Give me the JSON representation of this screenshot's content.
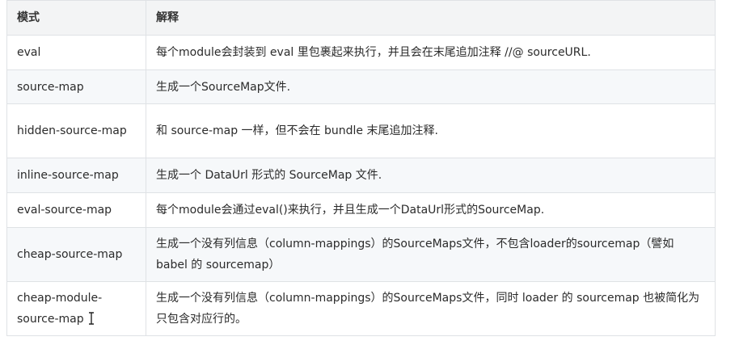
{
  "table": {
    "headers": [
      "模式",
      "解释"
    ],
    "rows": [
      {
        "mode": "eval",
        "desc": "每个module会封装到 eval 里包裹起来执行，并且会在末尾追加注释 //@ sourceURL."
      },
      {
        "mode": "source-map",
        "desc": "生成一个SourceMap文件."
      },
      {
        "mode": "hidden-source-map",
        "desc": "和 source-map 一样，但不会在 bundle 末尾追加注释."
      },
      {
        "mode": "inline-source-map",
        "desc": "生成一个 DataUrl 形式的 SourceMap 文件."
      },
      {
        "mode": "eval-source-map",
        "desc": "每个module会通过eval()来执行，并且生成一个DataUrl形式的SourceMap."
      },
      {
        "mode": "cheap-source-map",
        "desc": "生成一个没有列信息（column-mappings）的SourceMaps文件，不包含loader的sourcemap（譬如 babel 的 sourcemap）"
      },
      {
        "mode": "cheap-module-source-map",
        "desc": "生成一个没有列信息（column-mappings）的SourceMaps文件，同时 loader 的 sourcemap 也被简化为只包含对应行的。"
      }
    ]
  },
  "cursor": {
    "icon": "text-cursor-icon"
  }
}
